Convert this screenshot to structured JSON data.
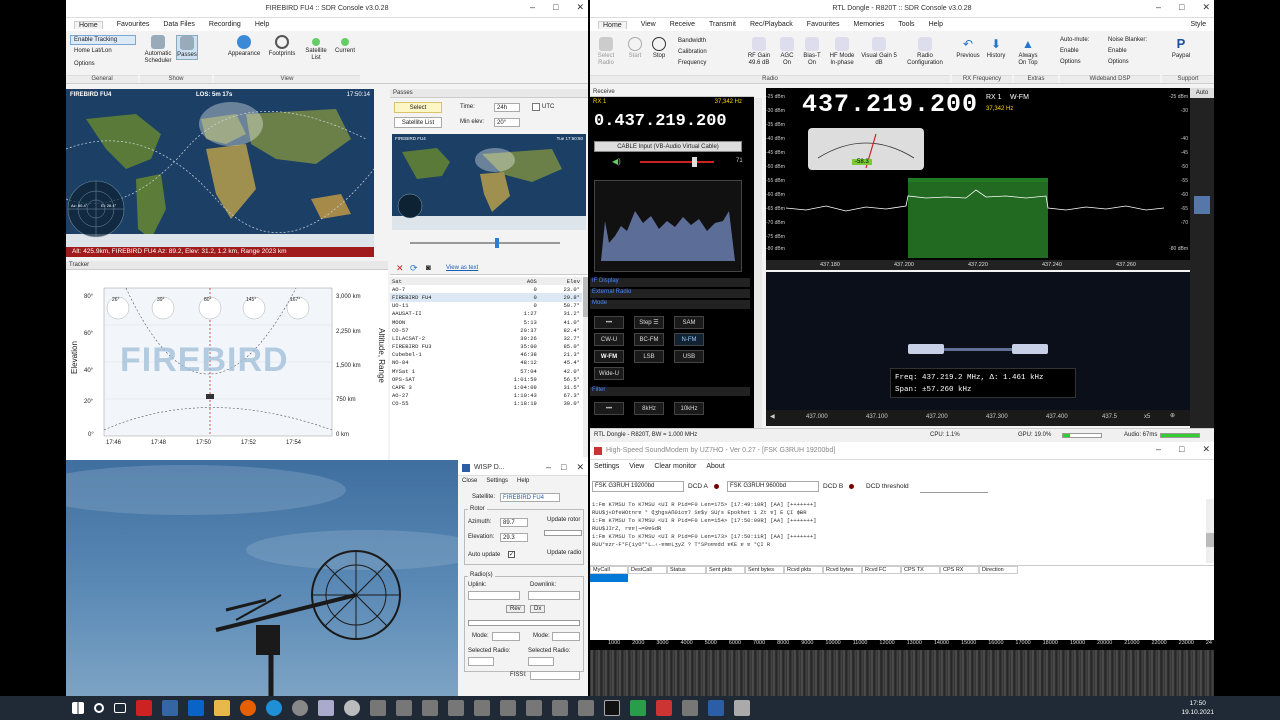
{
  "firebird": {
    "title": "FIREBIRD FU4 :: SDR Console v3.0.28",
    "tabs": [
      "Home",
      "Favourites",
      "Data Files",
      "Recording",
      "Help"
    ],
    "home_items": {
      "enable_tracking": "Enable Tracking",
      "home_latlon": "Home Lat/Lon",
      "options": "Options"
    },
    "ribbon_buttons": [
      "Automatic Scheduler",
      "Passes",
      "Appearance",
      "Footprints",
      "Satellite List",
      "Current"
    ],
    "groups": [
      "General",
      "Show",
      "View"
    ],
    "map_title": "FIREBIRD FU4",
    "los": "LOS: 5m 17s",
    "map_time": "17:50:14",
    "map_status": "Alt: 425.9km, FIREBIRD FU4 Az: 89.2, Elev: 31.2, 1.2 km, Range 2023 km",
    "radar_az": "Az: 80.4°",
    "radar_el": "El: 26.4°",
    "passes": {
      "title": "Passes",
      "select": "Select",
      "satellite_list": "Satellite List",
      "time_label": "Time:",
      "time_value": "24h",
      "utc": "UTC",
      "minelev_label": "Min elev:",
      "minelev_value": "20°",
      "map_label": "FIREBIRD FU4",
      "map_time": "Tue 17:50:50"
    },
    "tracker": {
      "title": "Tracker",
      "watermark": "FIREBIRD",
      "y_label": "Elevation",
      "y2_label": "Altitude, Range",
      "y_ticks": [
        "80°",
        "60°",
        "40°",
        "20°",
        "0°"
      ],
      "y2_ticks": [
        "3,000 km",
        "2,250 km",
        "1,500 km",
        "750 km",
        "0 km"
      ],
      "x_ticks": [
        "17:46",
        "17:48",
        "17:50",
        "17:52",
        "17:54"
      ],
      "az_markers": [
        "26°",
        "39°",
        "80°",
        "145°",
        "167°"
      ]
    },
    "sat_list": {
      "link": "View as text",
      "cols": [
        "Sat",
        "AOS",
        "Elev"
      ],
      "rows": [
        [
          "AO-7",
          "0",
          "23.0°"
        ],
        [
          "FIREBIRD FU4",
          "0",
          "29.8°"
        ],
        [
          "UO-11",
          "0",
          "50.7°"
        ],
        [
          "AAUSAT-II",
          "1:27",
          "31.2°"
        ],
        [
          "MOON",
          "5:13",
          "41.0°"
        ],
        [
          "CO-57",
          "20:37",
          "82.4°"
        ],
        [
          "LILACSAT-2",
          "30:26",
          "32.7°"
        ],
        [
          "FIREBIRD FU3",
          "35:00",
          "85.0°"
        ],
        [
          "Cubebel-1",
          "46:38",
          "21.3°"
        ],
        [
          "NO-84",
          "48:12",
          "45.4°"
        ],
        [
          "MYSat 1",
          "57:04",
          "42.0°"
        ],
        [
          "OPS-SAT",
          "1:01:59",
          "56.5°"
        ],
        [
          "CAPE 3",
          "1:04:09",
          "31.5°"
        ],
        [
          "AO-27",
          "1:10:43",
          "67.3°"
        ],
        [
          "CO-55",
          "1:18:19",
          "30.0°"
        ]
      ]
    }
  },
  "wisp": {
    "title": "WISP D...",
    "menu": [
      "Close",
      "Settings",
      "Help"
    ],
    "satellite_label": "Satellite:",
    "satellite_value": "FIREBIRD FU4",
    "rotor_label": "Rotor",
    "azimuth_label": "Azimuth:",
    "azimuth_value": "89.7",
    "elevation_label": "Elevation:",
    "elevation_value": "29.3",
    "update_rotor": "Update rotor",
    "auto_update": "Auto update",
    "update_radio": "Update radio",
    "radios_label": "Radio(s)",
    "uplink": "Uplink:",
    "downlink": "Downlink:",
    "rev": "Rev",
    "dx": "Dx",
    "mode": "Mode:",
    "selected_radio": "Selected Radio:",
    "fissi": "FISSI:"
  },
  "sdr": {
    "title": "RTL Dongle - R820T :: SDR Console v3.0.28",
    "style": "Style",
    "tabs": [
      "Home",
      "View",
      "Receive",
      "Transmit",
      "Rec/Playback",
      "Favourites",
      "Memories",
      "Tools",
      "Help"
    ],
    "ribbon": [
      "Select Radio",
      "Start",
      "Stop",
      "Bandwidth",
      "Calibration",
      "Frequency",
      "RF Gain 49.6 dB",
      "AGC On",
      "Bias-T On",
      "HF Mode In-phase",
      "Visual Gain 5 dB",
      "Radio Configuration",
      "Previous",
      "History",
      "Always On Top",
      "Auto-mute:",
      "Enable",
      "Options",
      "Noise Blanker:",
      "Enable",
      "Options",
      "Paypal"
    ],
    "groups": [
      "Radio",
      "RX Frequency",
      "Extras",
      "Wideband DSP",
      "Support"
    ],
    "receive_label": "Receive",
    "rx1": "RX 1",
    "rx_hz": "37,342 Hz",
    "freq_small": "0.437.219.200",
    "input": "CABLE Input (VB-Audio Virtual Cable)",
    "vol": "71",
    "sections": [
      "IF Display",
      "External Radio",
      "Mode",
      "Filter"
    ],
    "modes": [
      "•••",
      "Step ☰",
      "SAM",
      "CW-U",
      "BC-FM",
      "N-FM",
      "W-FM",
      "LSB",
      "USB",
      "Wide-U"
    ],
    "filters": [
      "•••",
      "8kHz",
      "10kHz"
    ],
    "big_freq": "437.219.200",
    "big_rx": "RX 1",
    "big_mode": "W-FM",
    "big_hz": "37,342 Hz",
    "smeter": "-58.3",
    "db_ticks": [
      "-25 dBm",
      "-30 dBm",
      "-35 dBm",
      "-40 dBm",
      "-45 dBm",
      "-50 dBm",
      "-55 dBm",
      "-60 dBm",
      "-65 dBm",
      "-70 dBm",
      "-75 dBm",
      "-80 dBm"
    ],
    "right_ticks": [
      "-25 dBm",
      "-30",
      "-40",
      "-45",
      "-50",
      "-55",
      "-60",
      "-65",
      "-70",
      "-80 dBm"
    ],
    "freq_ticks": [
      "437.180",
      "437.200",
      "437.220",
      "437.240",
      "437.260"
    ],
    "bottom_ticks": [
      "437.000",
      "437.100",
      "437.200",
      "437.300",
      "437.400",
      "437.5"
    ],
    "auto": "Auto",
    "wf_freq": "Freq: 437.219.2 MHz, Δ: 1.461 kHz",
    "wf_span": "Span:    ±57.260 kHz",
    "zoom": "x5",
    "status_left": "RTL Dongle - R820T, BW = 1.000 MHz",
    "cpu": "CPU: 1.1%",
    "gpu": "GPU: 19.0%",
    "audio": "Audio: 67ms"
  },
  "modem": {
    "title": "High-Speed SoundModem by UZ7HO - Ver 0.27 - [FSK G3RUH 19200bd]",
    "menu": [
      "Settings",
      "View",
      "Clear monitor",
      "About"
    ],
    "modem_a": "FSK G3RUH 19200bd",
    "dcd_a": "DCD A",
    "modem_b": "FSK G3RUH 9600bd",
    "dcd_b": "DCD B",
    "dcd_threshold": "DCD threshold",
    "log": [
      "1:Fm K7MSU To K7MSU <UI R Pid=F0 Len=175> [17:49:18R] [AA] [+++++++]",
      "RUU$j«DfeWOtnrɐ  ° ₵ʒhgsAß0iɢɤ7 Sɐ$y SUƒs  Epokhet  1 Zt ɐ] E ÇI ɸɃR",
      "1:Fm K7MSU To K7MSU <UI R Pid=F0 Len=154> [17:50:09R] [AA] [+++++++]",
      "RUU$JIrZ,  rɐɐ|¬=9ɐGdR",
      "1:Fm K7MSU To K7MSU <UI R Pid=F0 Len=173> [17:50:11R] [AA] [+++++++]",
      "RUU°ɐzr-F°F{iyO°°L…‹-ɐmɐLʒyZ    ? T°SPʊɐɐdd ɐ€E ɐ ɐ °ÇI R"
    ],
    "cols": [
      "MyCall",
      "DestCall",
      "Status",
      "Sent pkts",
      "Sent bytes",
      "Rcvd pkts",
      "Rcvd bytes",
      "Rcvd FC",
      "CPS TX",
      "CPS RX",
      "Direction"
    ],
    "spec_ticks": [
      "1000",
      "2000",
      "3000",
      "4000",
      "5000",
      "6000",
      "7000",
      "8000",
      "9000",
      "10000",
      "11000",
      "12000",
      "13000",
      "14000",
      "15000",
      "16000",
      "17000",
      "18000",
      "19000",
      "20000",
      "21000",
      "22000",
      "23000",
      "24"
    ]
  },
  "clock": {
    "time": "17:50",
    "date": "19.10.2021"
  },
  "colors": {
    "accent": "#0078d7",
    "green_passband": "#3fbf3f",
    "freq_yellow": "#ffd400",
    "taskbar": "#1f2a36"
  }
}
